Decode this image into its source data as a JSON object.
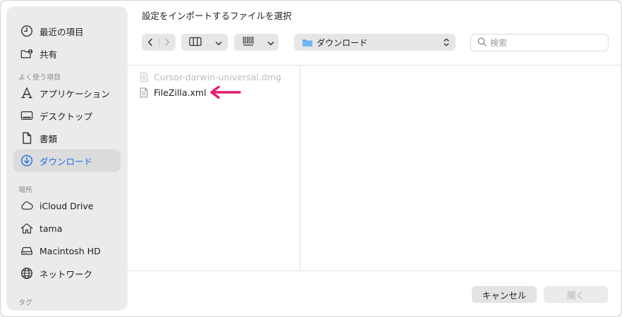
{
  "dialog": {
    "title": "設定をインポートするファイルを選択"
  },
  "sidebar": {
    "top_items": [
      {
        "label": "最近の項目",
        "icon": "clock-icon"
      },
      {
        "label": "共有",
        "icon": "shared-folder-icon"
      }
    ],
    "favorites_header": "よく使う項目",
    "favorites": [
      {
        "label": "アプリケーション",
        "icon": "applications-icon"
      },
      {
        "label": "デスクトップ",
        "icon": "desktop-icon"
      },
      {
        "label": "書類",
        "icon": "document-icon"
      },
      {
        "label": "ダウンロード",
        "icon": "download-icon",
        "selected": true
      }
    ],
    "locations_header": "場所",
    "locations": [
      {
        "label": "iCloud Drive",
        "icon": "cloud-icon"
      },
      {
        "label": "tama",
        "icon": "home-icon"
      },
      {
        "label": "Macintosh HD",
        "icon": "drive-icon"
      },
      {
        "label": "ネットワーク",
        "icon": "globe-icon"
      }
    ],
    "tags_header": "タグ"
  },
  "toolbar": {
    "location": "ダウンロード",
    "search_placeholder": "検索"
  },
  "files": [
    {
      "name": "Cursor-darwin-universal.dmg",
      "enabled": false
    },
    {
      "name": "FileZilla.xml",
      "enabled": true
    }
  ],
  "annotation": {
    "arrow_color": "#e8196d"
  },
  "buttons": {
    "cancel": "キャンセル",
    "open": "開く"
  },
  "colors": {
    "accent": "#1f6fe5",
    "folder": "#5aa9f2"
  }
}
